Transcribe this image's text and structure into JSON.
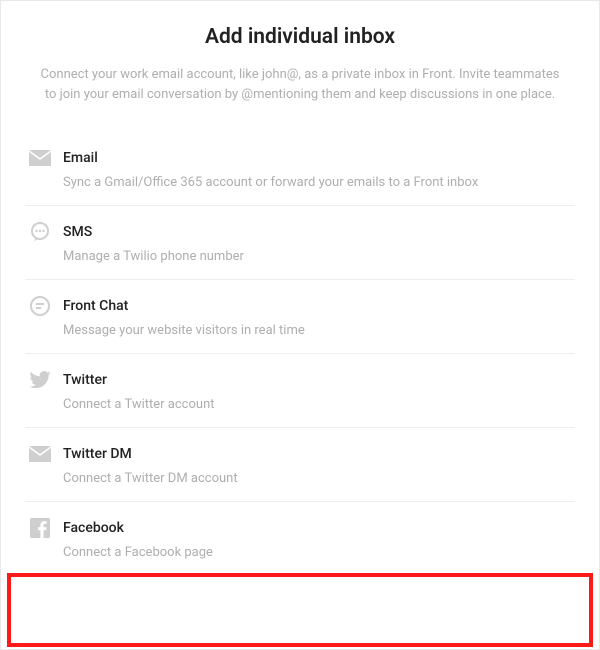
{
  "title": "Add individual inbox",
  "subtitle": "Connect your work email account, like john@, as a private inbox in Front. Invite teammates to join your email conversation by @mentioning them and keep discussions in one place.",
  "options": [
    {
      "icon": "email-icon",
      "label": "Email",
      "desc": "Sync a Gmail/Office 365 account or forward your emails to a Front inbox"
    },
    {
      "icon": "sms-icon",
      "label": "SMS",
      "desc": "Manage a Twilio phone number"
    },
    {
      "icon": "front-chat-icon",
      "label": "Front Chat",
      "desc": "Message your website visitors in real time"
    },
    {
      "icon": "twitter-icon",
      "label": "Twitter",
      "desc": "Connect a Twitter account"
    },
    {
      "icon": "twitter-dm-icon",
      "label": "Twitter DM",
      "desc": "Connect a Twitter DM account"
    },
    {
      "icon": "facebook-icon",
      "label": "Facebook",
      "desc": "Connect a Facebook page"
    }
  ],
  "highlighted_index": 5,
  "colors": {
    "highlight": "#ff1a1a",
    "muted": "#aeaeae",
    "text": "#222222"
  }
}
